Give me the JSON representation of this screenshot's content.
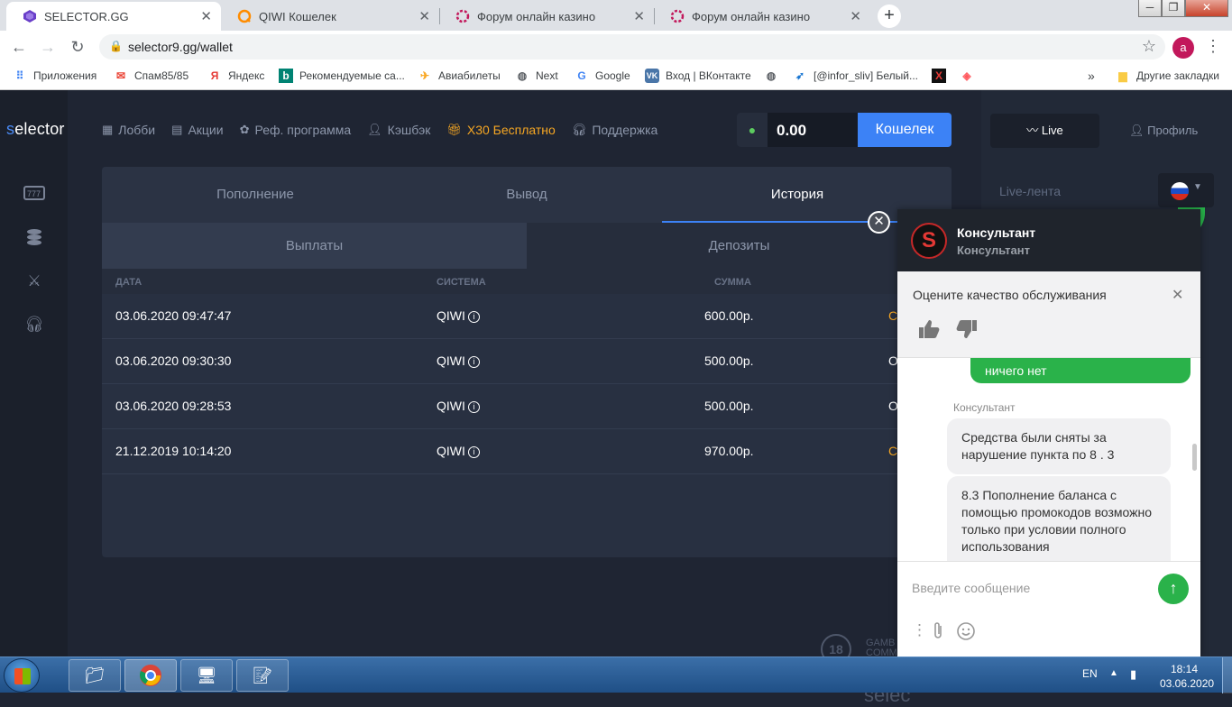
{
  "browser": {
    "tabs": [
      {
        "title": "SELECTOR.GG",
        "favicon": "selector-icon",
        "active": true
      },
      {
        "title": "QIWI Кошелек",
        "favicon": "qiwi-icon",
        "active": false
      },
      {
        "title": "Форум онлайн казино",
        "favicon": "casino-forum-icon",
        "active": false
      },
      {
        "title": "Форум онлайн казино",
        "favicon": "casino-forum-icon",
        "active": false
      }
    ],
    "new_tab_label": "+",
    "url": "selector9.gg/wallet",
    "profile_initial": "a",
    "bookmarks": [
      {
        "label": "Приложения",
        "icon": "apps-grid-icon"
      },
      {
        "label": "Спам85/85",
        "icon": "gmail-icon"
      },
      {
        "label": "Яндекс",
        "icon": "yandex-icon"
      },
      {
        "label": "Рекомендуемые са...",
        "icon": "bing-icon"
      },
      {
        "label": "Авиабилеты",
        "icon": "plane-icon"
      },
      {
        "label": "Next",
        "icon": "globe-icon"
      },
      {
        "label": "Google",
        "icon": "google-icon"
      },
      {
        "label": "Вход | ВКонтакте",
        "icon": "vk-icon"
      },
      {
        "label": "",
        "icon": "globe-icon"
      },
      {
        "label": "[@infor_sliv] Белый...",
        "icon": "bird-icon"
      },
      {
        "label": "",
        "icon": "x-icon"
      },
      {
        "label": "",
        "icon": "airbnb-icon"
      }
    ],
    "more_bookmarks": "»",
    "other_bookmarks": "Другие закладки"
  },
  "site": {
    "logo_prefix": "s",
    "logo_rest": "elector",
    "nav": [
      {
        "label": "Лобби",
        "icon": "lobby-icon"
      },
      {
        "label": "Акции",
        "icon": "promo-icon"
      },
      {
        "label": "Реф. программа",
        "icon": "referral-icon"
      },
      {
        "label": "Кэшбэк",
        "icon": "user-icon"
      },
      {
        "label": "X30 Бесплатно",
        "icon": "gift-icon"
      },
      {
        "label": "Поддержка",
        "icon": "headset-icon"
      }
    ],
    "balance": "0.00",
    "wallet_button": "Кошелек",
    "live_button": "Live",
    "profile_button": "Профиль",
    "live_feed": "Live-лента",
    "footer_logo": "selec",
    "age_badge": "18",
    "gamecare": "GAMB\nCOMM"
  },
  "wallet": {
    "tabs": [
      "Пополнение",
      "Вывод",
      "История"
    ],
    "active_tab": "История",
    "subtabs": [
      "Выплаты",
      "Депозиты"
    ],
    "columns": [
      "ДАТА",
      "СИСТЕМА",
      "СУММА"
    ],
    "rows": [
      {
        "date": "03.06.2020 09:47:47",
        "system": "QIWI",
        "amount": "600.00р.",
        "status": "С",
        "status_color": "#f5a623"
      },
      {
        "date": "03.06.2020 09:30:30",
        "system": "QIWI",
        "amount": "500.00р.",
        "status": "От",
        "status_color": "#ffffff"
      },
      {
        "date": "03.06.2020 09:28:53",
        "system": "QIWI",
        "amount": "500.00р.",
        "status": "От",
        "status_color": "#ffffff"
      },
      {
        "date": "21.12.2019 10:14:20",
        "system": "QIWI",
        "amount": "970.00р.",
        "status": "С",
        "status_color": "#f5a623"
      }
    ]
  },
  "chat": {
    "avatar_letter": "S",
    "title": "Консультант",
    "subtitle": "Консультант",
    "rating_prompt": "Оцените качество обслуживания",
    "my_message": "ничего нет",
    "operator_label": "Консультант",
    "operator_messages": [
      "Средства были сняты за нарушение пункта по 8 . 3",
      "8.3 Пополнение баланса с помощью промокодов возможно только при условии полного использования"
    ],
    "input_placeholder": "Введите сообщение"
  },
  "taskbar": {
    "lang": "EN",
    "time": "18:14",
    "date": "03.06.2020"
  },
  "colors": {
    "accent": "#3c82f6",
    "gold": "#f5a623",
    "chat_green": "#2ab24a"
  }
}
